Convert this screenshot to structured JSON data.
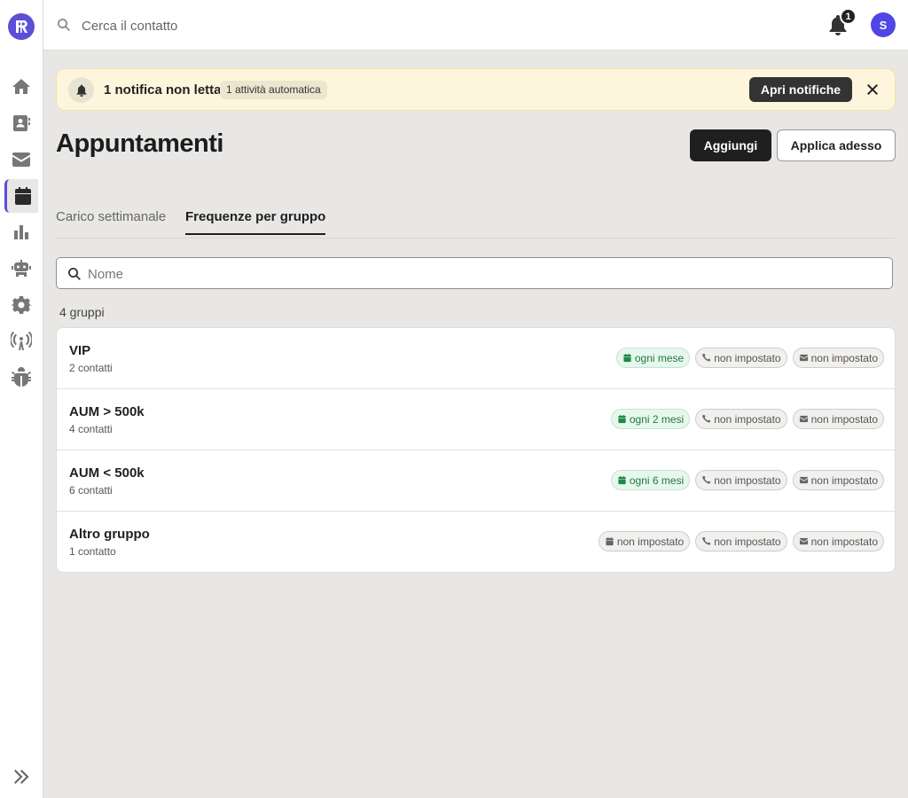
{
  "sidebar": {
    "logo_icon": "brand-logo-icon",
    "items": [
      {
        "icon": "home-icon"
      },
      {
        "icon": "contacts-icon"
      },
      {
        "icon": "mail-icon"
      },
      {
        "icon": "calendar-icon",
        "active": true
      },
      {
        "icon": "bar-chart-icon"
      },
      {
        "icon": "robot-icon"
      },
      {
        "icon": "gear-icon"
      },
      {
        "icon": "antenna-icon"
      },
      {
        "icon": "bug-icon"
      }
    ],
    "expand_icon": "double-chevron-right-icon"
  },
  "topbar": {
    "search_placeholder": "Cerca il contatto",
    "notification_count": "1",
    "avatar_initial": "S"
  },
  "banner": {
    "title": "1 notifica non letta",
    "chip": "1 attività automatica",
    "button": "Apri notifiche"
  },
  "page": {
    "title": "Appuntamenti",
    "add_button": "Aggiungi",
    "apply_button": "Applica adesso"
  },
  "tabs": [
    {
      "label": "Carico settimanale",
      "active": false
    },
    {
      "label": "Frequenze per gruppo",
      "active": true
    }
  ],
  "filter": {
    "placeholder": "Nome"
  },
  "groups_count": "4 gruppi",
  "groups": [
    {
      "name": "VIP",
      "contacts": "2 contatti",
      "meeting": {
        "label": "ogni mese",
        "set": true
      },
      "call": {
        "label": "non impostato",
        "set": false
      },
      "email": {
        "label": "non impostato",
        "set": false
      }
    },
    {
      "name": "AUM > 500k",
      "contacts": "4 contatti",
      "meeting": {
        "label": "ogni 2 mesi",
        "set": true
      },
      "call": {
        "label": "non impostato",
        "set": false
      },
      "email": {
        "label": "non impostato",
        "set": false
      }
    },
    {
      "name": "AUM < 500k",
      "contacts": "6 contatti",
      "meeting": {
        "label": "ogni 6 mesi",
        "set": true
      },
      "call": {
        "label": "non impostato",
        "set": false
      },
      "email": {
        "label": "non impostato",
        "set": false
      }
    },
    {
      "name": "Altro gruppo",
      "contacts": "1 contatto",
      "meeting": {
        "label": "non impostato",
        "set": false
      },
      "call": {
        "label": "non impostato",
        "set": false
      },
      "email": {
        "label": "non impostato",
        "set": false
      }
    }
  ],
  "colors": {
    "accent": "#5a4fd6",
    "avatar": "#4f46e5",
    "green_text": "#1f7a3e",
    "banner_bg": "#fdf6dd"
  }
}
